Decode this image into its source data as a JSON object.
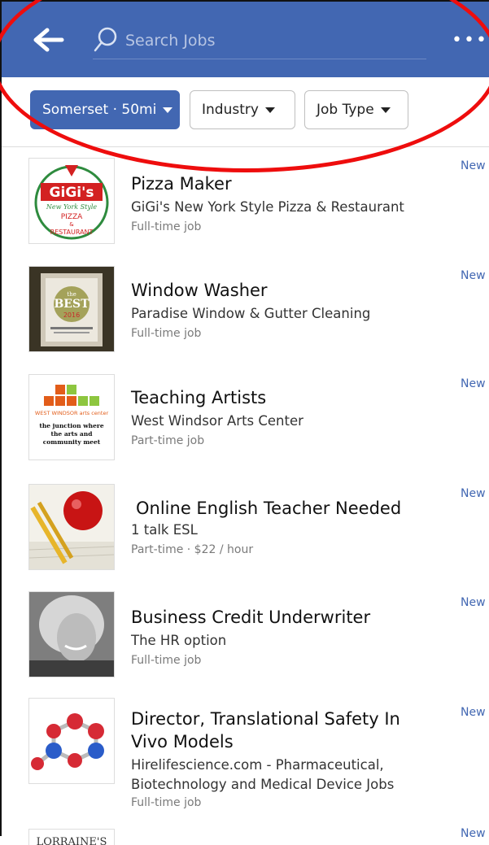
{
  "header": {
    "search_placeholder": "Search Jobs",
    "more_label": "•••"
  },
  "filters": [
    {
      "label": "Somerset · 50mi",
      "active": true
    },
    {
      "label": "Industry",
      "active": false
    },
    {
      "label": "Job Type",
      "active": false
    }
  ],
  "jobs": [
    {
      "title": "Pizza Maker",
      "company": "GiGi's New York Style Pizza & Restaurant",
      "meta": "Full-time job",
      "badge": "New",
      "thumb_text": [
        "GiGi's",
        "New York Style",
        "PIZZA",
        "&",
        "RESTAURANT"
      ]
    },
    {
      "title": "Window Washer",
      "company": "Paradise Window & Gutter Cleaning",
      "meta": "Full-time job",
      "badge": "New",
      "thumb_text": [
        "the",
        "BEST",
        "2016"
      ]
    },
    {
      "title": "Teaching Artists",
      "company": "West Windsor Arts Center",
      "meta": "Part-time job",
      "badge": "New",
      "thumb_text": [
        "WEST WINDSOR arts center",
        "the junction where",
        "the arts and",
        "community meet"
      ]
    },
    {
      "title": "Online English Teacher Needed",
      "company": "1 talk ESL",
      "meta": "Part-time · $22 / hour",
      "badge": "New"
    },
    {
      "title": "Business Credit Underwriter",
      "company": "The HR option",
      "meta": "Full-time job",
      "badge": "New"
    },
    {
      "title": "Director, Translational Safety In Vivo Models",
      "company": "Hirelifescience.com - Pharmaceutical, Biotechnology and Medical Device Jobs",
      "meta": "Full-time job",
      "badge": "New"
    },
    {
      "title": "",
      "company": "",
      "meta": "",
      "badge": "New",
      "thumb_text": [
        "LORRAINE'S"
      ]
    }
  ],
  "colors": {
    "brand": "#4267b2",
    "annotation": "#ee0d0d"
  }
}
